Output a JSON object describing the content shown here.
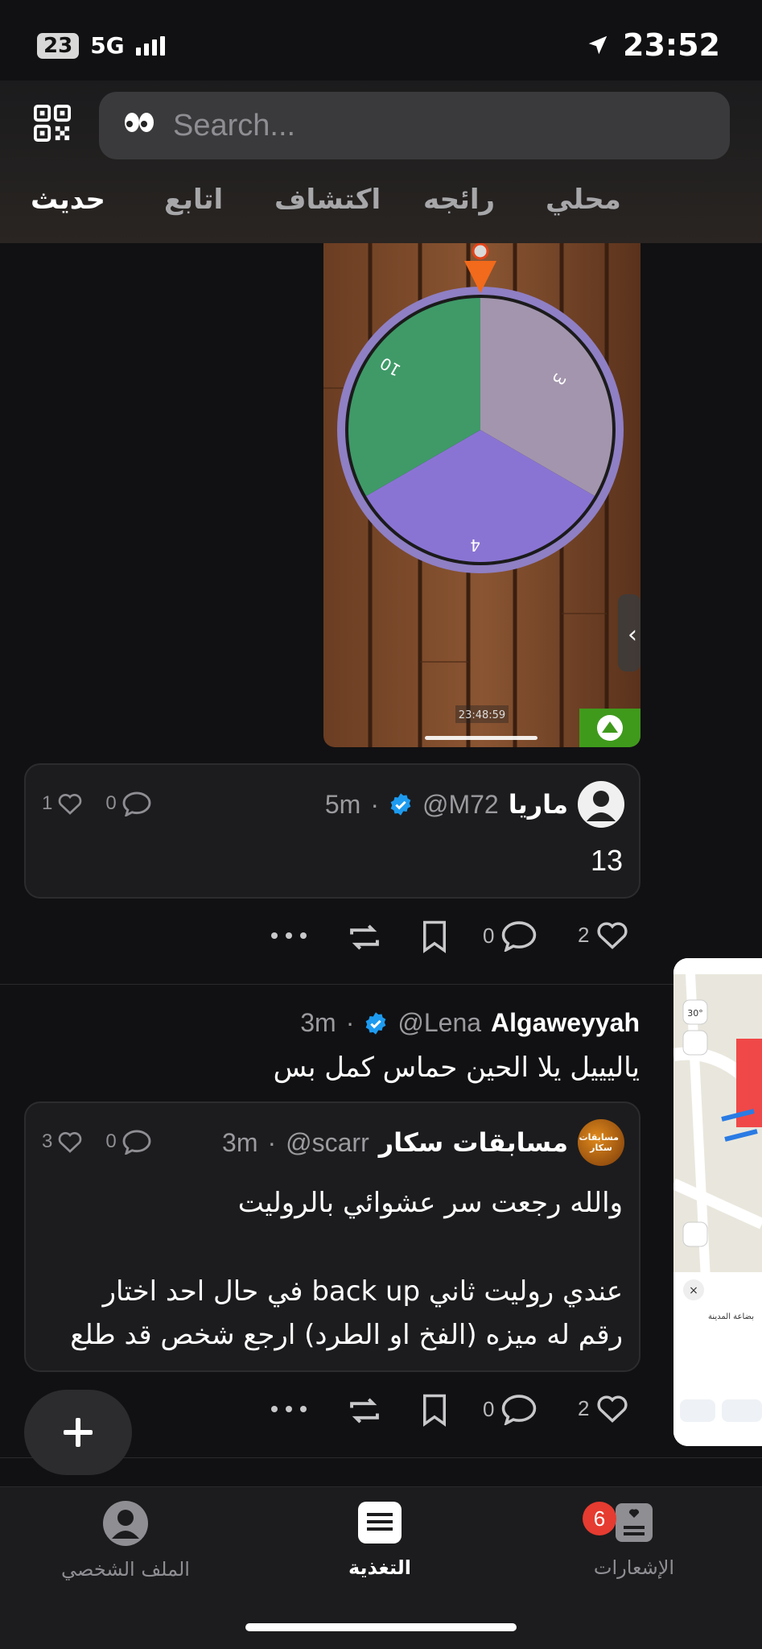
{
  "status": {
    "battery": "23",
    "network": "5G",
    "time": "23:52"
  },
  "search": {
    "placeholder": "Search..."
  },
  "tabs": [
    {
      "label": "محلي",
      "active": false
    },
    {
      "label": "رائجه",
      "active": false
    },
    {
      "label": "اكتشاف",
      "active": false
    },
    {
      "label": "اتابع",
      "active": false
    },
    {
      "label": "حديث",
      "active": true
    }
  ],
  "wheel": {
    "segments": [
      "3",
      "4",
      "10"
    ],
    "timestamp": "23:48:59"
  },
  "post1": {
    "quote": {
      "name": "ماريا",
      "handle": "@M72",
      "time": "5m",
      "likes": "1",
      "comments": "0",
      "text": "13"
    },
    "likes": "2",
    "comments": "0"
  },
  "post2": {
    "name": "Algaweyyah",
    "handle": "@Lena",
    "time": "3m",
    "text": "ياليييل يلا الحين حماس كمل بس",
    "quote": {
      "name": "مسابقات سكار",
      "handle": "@scarr",
      "time": "3m",
      "likes": "3",
      "comments": "0",
      "avatar_text": "مسابقات سكار",
      "line1": "والله رجعت سر عشوائي بالروليت",
      "line2": "عندي روليت ثاني back up في حال احد اختار",
      "line3": "رقم له ميزه (الفخ او الطرد) ارجع شخص قد طلع"
    },
    "likes": "2",
    "comments": "0"
  },
  "map_thumb": {
    "temp": "30°",
    "snippet": "بضاعة المدينة"
  },
  "tabbar": {
    "profile": "الملف الشخصي",
    "feed": "التغذية",
    "notifications": "الإشعارات",
    "notif_count": "6"
  },
  "colors": {
    "accent_verified": "#1d9bf0",
    "badge": "#e63b30",
    "wheel_green": "#3f9a68",
    "wheel_grey": "#a395ad",
    "wheel_purple": "#8a74d3"
  }
}
